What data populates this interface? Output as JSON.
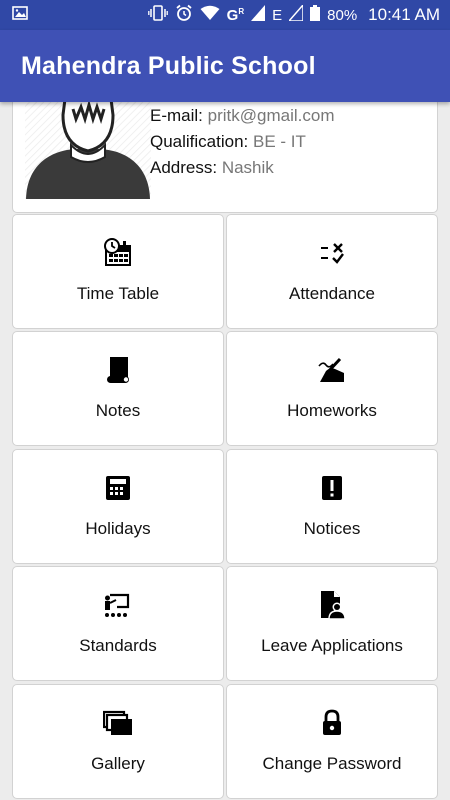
{
  "status_bar": {
    "battery": "80%",
    "time": "10:41 AM",
    "network_g": "G",
    "network_r": "R",
    "network_e": "E"
  },
  "app_bar": {
    "title": "Mahendra Public School"
  },
  "profile": {
    "email_label": "E-mail:",
    "email": "pritk@gmail.com",
    "qualification_label": "Qualification:",
    "qualification": "BE - IT",
    "address_label": "Address:",
    "address": "Nashik"
  },
  "menu": [
    {
      "label": "Time Table",
      "icon": "calendar-clock-icon"
    },
    {
      "label": "Attendance",
      "icon": "attendance-checklist-icon"
    },
    {
      "label": "Notes",
      "icon": "scroll-icon"
    },
    {
      "label": "Homeworks",
      "icon": "hand-writing-icon"
    },
    {
      "label": "Holidays",
      "icon": "calculator-icon"
    },
    {
      "label": "Notices",
      "icon": "notice-alert-icon"
    },
    {
      "label": "Standards",
      "icon": "class-presentation-icon"
    },
    {
      "label": "Leave Applications",
      "icon": "document-person-icon"
    },
    {
      "label": "Gallery",
      "icon": "gallery-cards-icon"
    },
    {
      "label": "Change Password",
      "icon": "lock-icon"
    }
  ],
  "colors": {
    "status_bar": "#3048a6",
    "app_bar": "#3f51b5",
    "background": "#ececec",
    "card": "#ffffff"
  }
}
